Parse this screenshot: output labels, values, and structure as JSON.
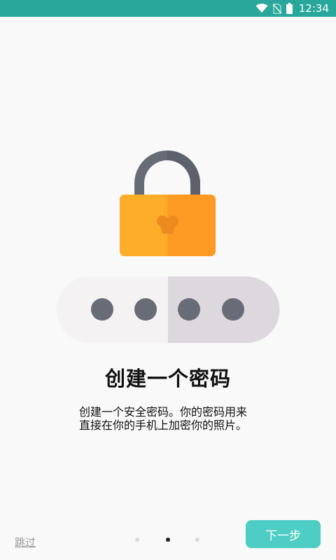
{
  "status_bar": {
    "time": "12:34",
    "icons": [
      "wifi-icon",
      "no-sim-icon",
      "battery-icon"
    ],
    "background": "#2aa79b"
  },
  "illustration": {
    "icon": "padlock-icon",
    "password_dots": 4,
    "colors": {
      "shackle": "#666b76",
      "lock_body_left": "#fdad2a",
      "lock_body_right": "#fd9a23",
      "field_left": "#f4f2f2",
      "field_right": "#dcd8dd",
      "dot": "#686c77"
    }
  },
  "content": {
    "title": "创建一个密码",
    "description_lines": [
      "创建一个安全密码。你的密码用来",
      "直接在你的手机上加密你的照片。"
    ]
  },
  "footer": {
    "skip_label": "跳过",
    "next_label": "下一步",
    "pages_total": 3,
    "current_page": 2,
    "accent_color": "#4ecdc4"
  }
}
